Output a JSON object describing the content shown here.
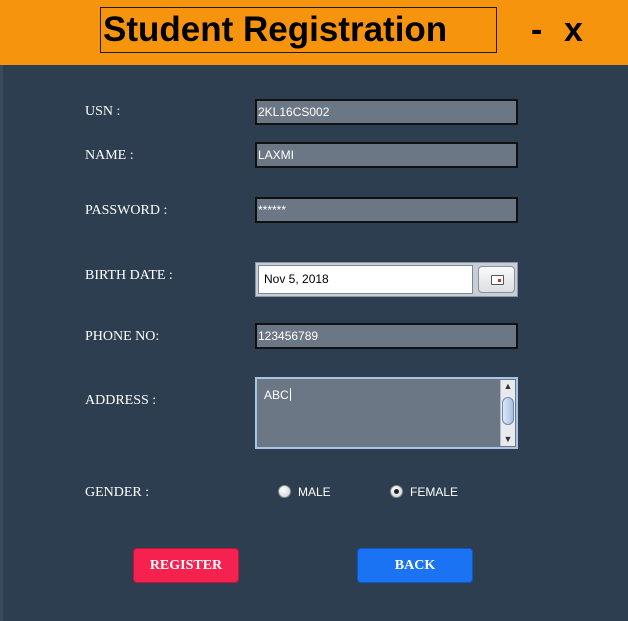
{
  "window": {
    "title": "Student Registration",
    "minimize_label": "-",
    "close_label": "x"
  },
  "colors": {
    "titlebar": "#f7940d",
    "background": "#2c3e50",
    "field_bg": "#6b7785",
    "register_button": "#f5214f",
    "back_button": "#1a73f2"
  },
  "form": {
    "usn": {
      "label": "USN :",
      "value": "2KL16CS002"
    },
    "name": {
      "label": "NAME :",
      "value": "LAXMI"
    },
    "password": {
      "label": "PASSWORD :",
      "value": "******"
    },
    "birth_date": {
      "label": "BIRTH DATE :",
      "value": "Nov 5, 2018",
      "picker_icon": "calendar-icon"
    },
    "phone": {
      "label": "PHONE NO:",
      "value": "123456789"
    },
    "address": {
      "label": "ADDRESS :",
      "value": "ABC"
    },
    "gender": {
      "label": "GENDER :",
      "options": [
        {
          "label": "MALE",
          "selected": false
        },
        {
          "label": "FEMALE",
          "selected": true
        }
      ]
    }
  },
  "buttons": {
    "register": "REGISTER",
    "back": "BACK"
  }
}
